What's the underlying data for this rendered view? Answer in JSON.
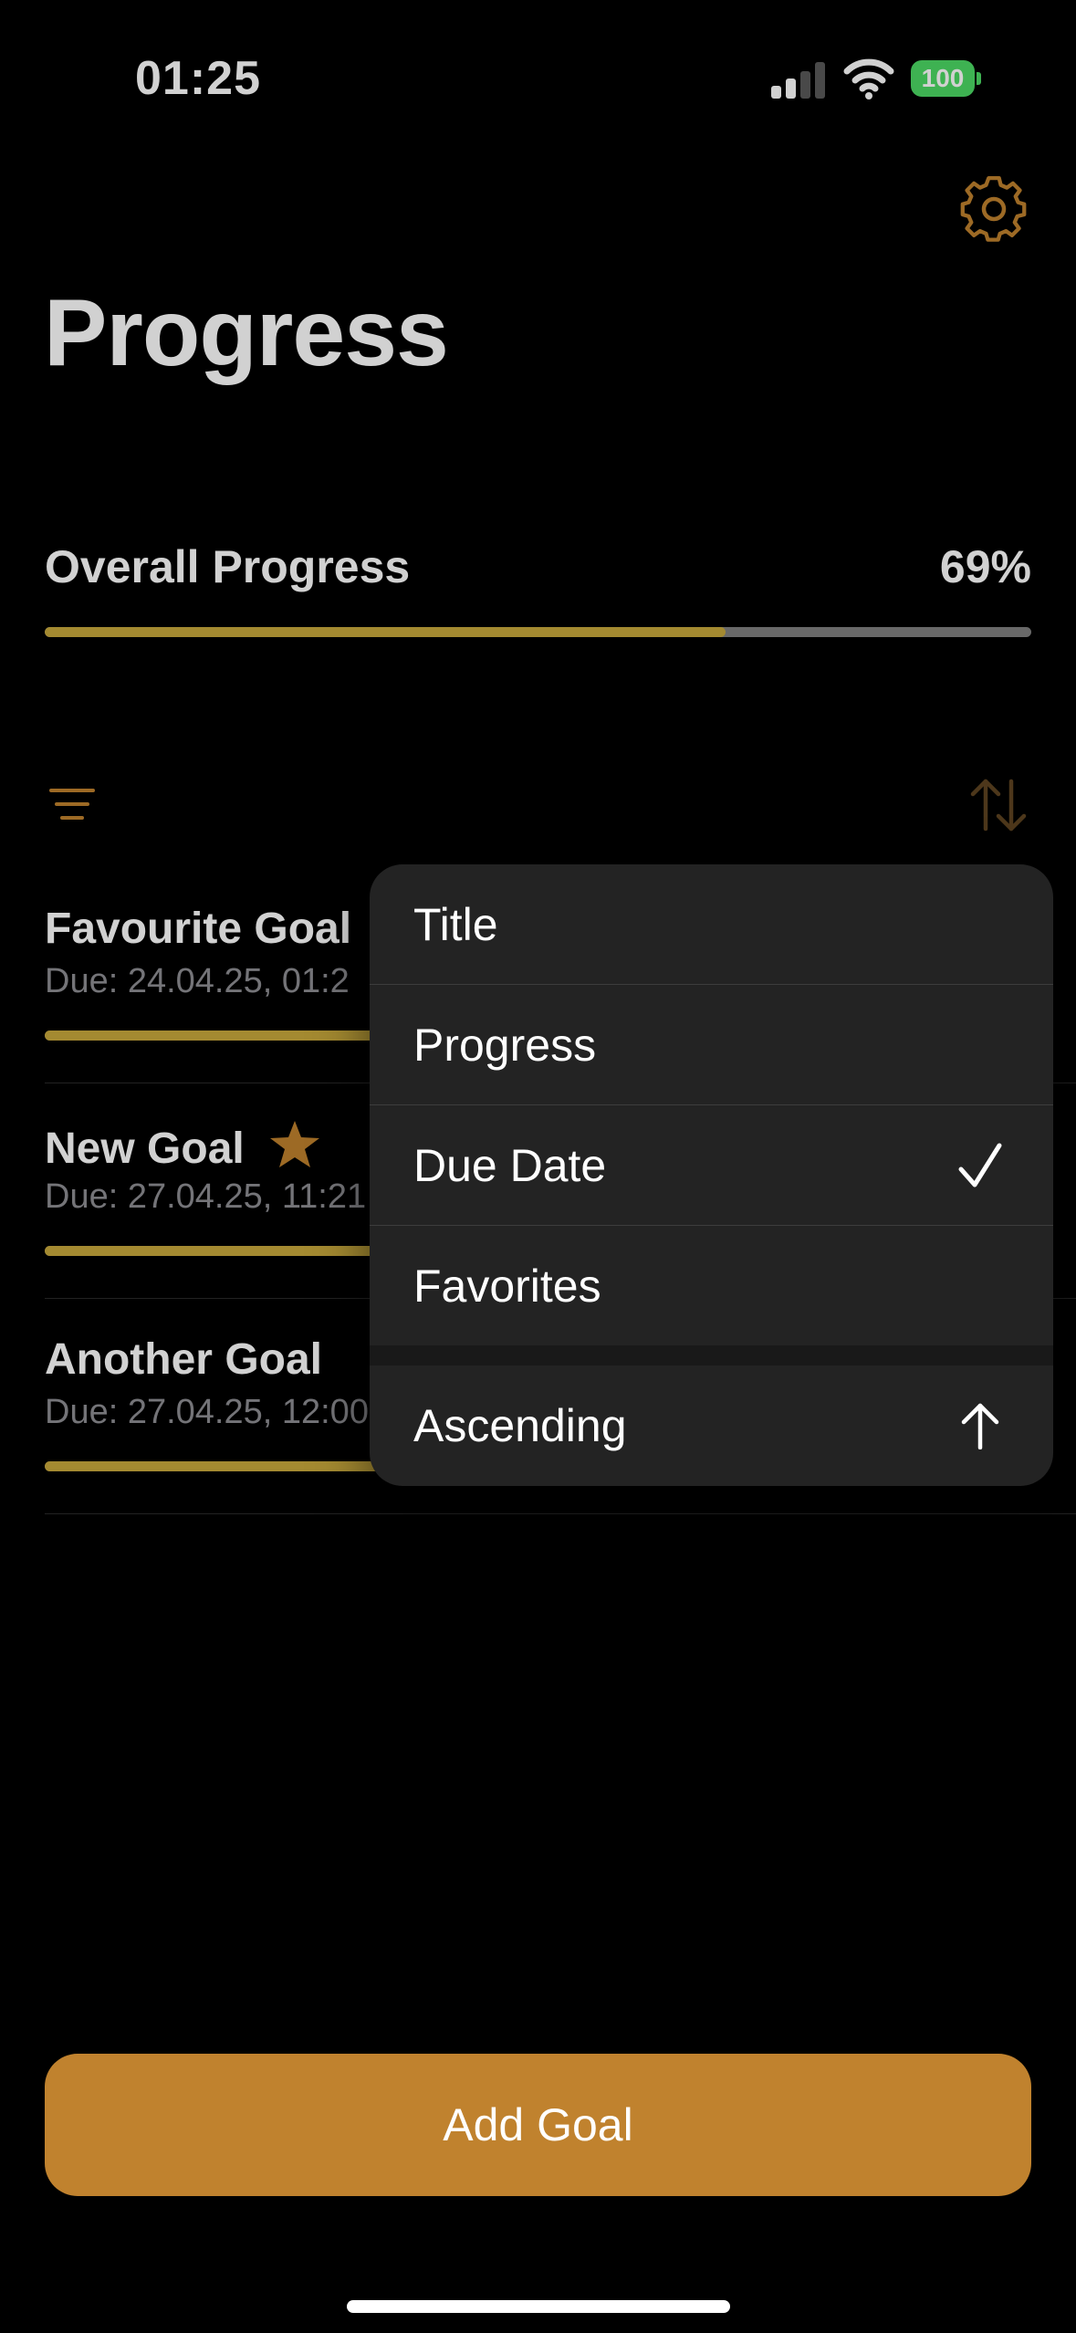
{
  "status_bar": {
    "time": "01:25",
    "battery": "100",
    "signal_bars_filled": 2,
    "signal_bars_total": 4
  },
  "header": {
    "title": "Progress",
    "settings_icon": "gear-icon"
  },
  "overall": {
    "label": "Overall Progress",
    "percent_text": "69%",
    "progress": 0.69
  },
  "toolbar": {
    "filter_icon": "filter-lines-icon",
    "sort_icon": "sort-arrows-icon"
  },
  "goals": [
    {
      "title": "Favourite Goal",
      "due": "Due: 24.04.25, 01:2",
      "favorite": false
    },
    {
      "title": "New Goal",
      "due": "Due: 27.04.25, 11:21",
      "favorite": true
    },
    {
      "title": "Another Goal",
      "due": "Due: 27.04.25, 12:00",
      "favorite": false
    }
  ],
  "sort_menu": {
    "items": [
      {
        "label": "Title",
        "selected": false
      },
      {
        "label": "Progress",
        "selected": false
      },
      {
        "label": "Due Date",
        "selected": true
      },
      {
        "label": "Favorites",
        "selected": false
      }
    ],
    "order": {
      "label": "Ascending",
      "icon": "arrow-up-icon"
    }
  },
  "actions": {
    "add_goal": "Add Goal"
  },
  "colors": {
    "accent": "#c0822e",
    "progress_fill": "#c9a93c",
    "star": "#c0822e",
    "battery": "#4cd964"
  }
}
